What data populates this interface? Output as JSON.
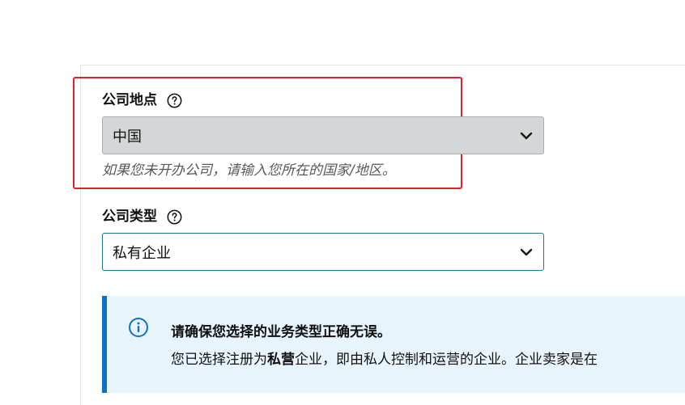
{
  "company_location": {
    "label": "公司地点",
    "selected_value": "中国",
    "hint": "如果您未开办公司，请输入您所在的国家/地区。"
  },
  "company_type": {
    "label": "公司类型",
    "selected_value": "私有企业"
  },
  "info_notice": {
    "title": "请确保您选择的业务类型正确无误。",
    "body_prefix": "您已选择注册为",
    "body_emphasis": "私营",
    "body_suffix": "企业，即由私人控制和运营的企业。企业卖家是在"
  },
  "colors": {
    "highlight_border": "#e4202a",
    "info_accent": "#0f70c8",
    "info_background": "#e8f4fb",
    "active_select_border": "#1b7a8a"
  }
}
